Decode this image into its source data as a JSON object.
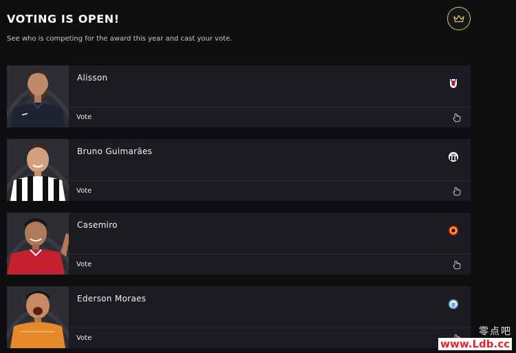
{
  "header": {
    "title": "VOTING IS OPEN!",
    "subtitle": "See who is competing for the award this year and cast your vote.",
    "crown_icon": "crown-icon",
    "accent_color": "#d8c66a"
  },
  "players": [
    {
      "name": "Alisson",
      "vote_label": "Vote",
      "club_icon": "liverpool-badge-icon"
    },
    {
      "name": "Bruno Guimarães",
      "vote_label": "Vote",
      "club_icon": "newcastle-badge-icon"
    },
    {
      "name": "Casemiro",
      "vote_label": "Vote",
      "club_icon": "manchester-united-badge-icon"
    },
    {
      "name": "Ederson Moraes",
      "vote_label": "Vote",
      "club_icon": "manchester-city-badge-icon"
    }
  ],
  "watermark": {
    "top": "零点吧",
    "bottom": "www.Ldb.cc"
  }
}
